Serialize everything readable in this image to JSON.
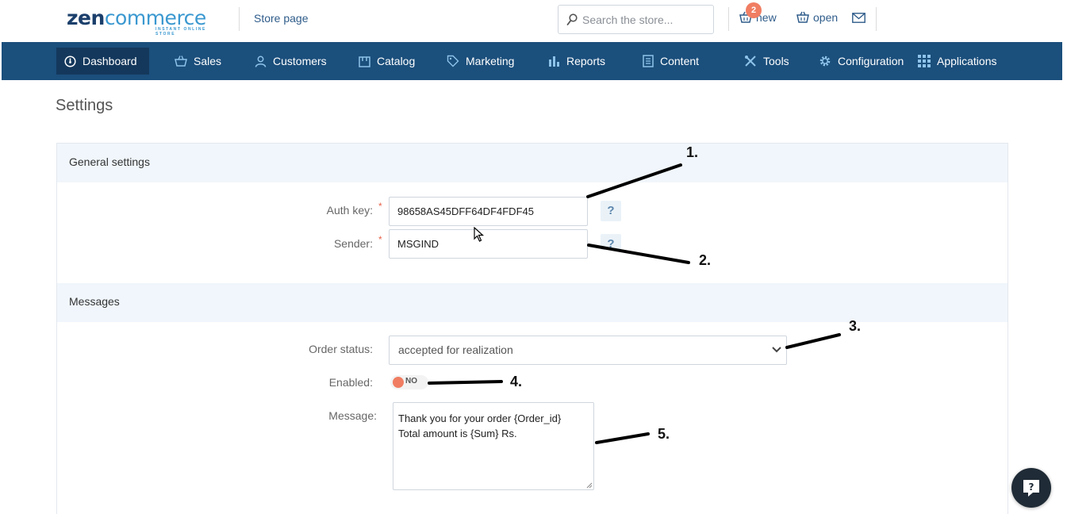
{
  "header": {
    "logo_main": "zencommerce",
    "logo_tagline": "INSTANT ONLINE STORE",
    "store_link": "Store page",
    "search_placeholder": "Search the store...",
    "new_orders_count": "2",
    "new_label": "new",
    "open_label": "open"
  },
  "nav": {
    "items": [
      {
        "label": "Dashboard",
        "icon": "dashboard-icon",
        "active": true
      },
      {
        "label": "Sales",
        "icon": "basket-icon"
      },
      {
        "label": "Customers",
        "icon": "user-icon"
      },
      {
        "label": "Catalog",
        "icon": "box-icon"
      },
      {
        "label": "Marketing",
        "icon": "tag-icon"
      },
      {
        "label": "Reports",
        "icon": "bar-chart-icon"
      },
      {
        "label": "Content",
        "icon": "document-icon"
      },
      {
        "label": "Tools",
        "icon": "tools-icon"
      },
      {
        "label": "Configuration",
        "icon": "gear-icon"
      },
      {
        "label": "Applications",
        "icon": "grid-icon"
      }
    ]
  },
  "page": {
    "title": "Settings"
  },
  "general": {
    "heading": "General settings",
    "auth_key_label": "Auth key:",
    "auth_key_value": "98658AS45DFF64DF4FDF45",
    "sender_label": "Sender:",
    "sender_value": "MSGIND",
    "required_mark": "*",
    "help_mark": "?"
  },
  "messages": {
    "heading": "Messages",
    "order_status_label": "Order status:",
    "order_status_value": "accepted  for  realization",
    "enabled_label": "Enabled:",
    "enabled_value": "NO",
    "message_label": "Message:",
    "message_line1": "Thank you for your order {Order_id}",
    "message_line2": "Total amount is {Sum} Rs."
  },
  "annotations": [
    "1.",
    "2.",
    "3.",
    "4.",
    "5."
  ],
  "colors": {
    "nav_bg": "#1b4f7c",
    "nav_active": "#14385c",
    "badge": "#f07d62",
    "section_bg": "#f0f6fb"
  }
}
